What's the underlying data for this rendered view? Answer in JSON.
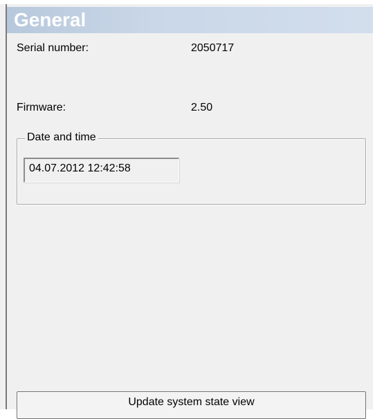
{
  "header": {
    "title": "General"
  },
  "info": {
    "serial_label": "Serial number:",
    "serial_value": "2050717",
    "firmware_label": "Firmware:",
    "firmware_value": "2.50"
  },
  "datetime_group": {
    "legend": "Date and time",
    "value": "04.07.2012 12:42:58"
  },
  "actions": {
    "update_label": "Update system state view"
  },
  "colors": {
    "header_background": "#c9d7e8",
    "header_text": "#ffffff",
    "panel_background": "#f0f0f0"
  }
}
